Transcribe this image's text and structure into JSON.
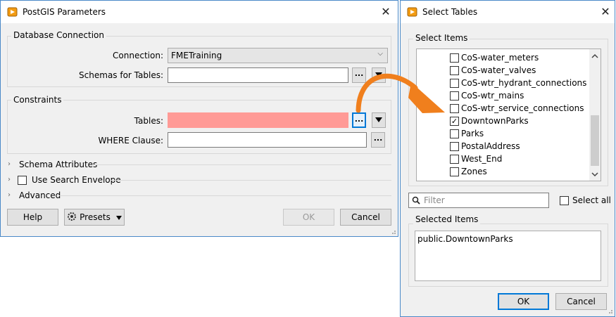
{
  "postgis": {
    "title": "PostGIS Parameters",
    "db_group": "Database Connection",
    "connection_label": "Connection:",
    "connection_value": "FMETraining",
    "schemas_label": "Schemas for Tables:",
    "schemas_value": "",
    "constraints_group": "Constraints",
    "tables_label": "Tables:",
    "tables_value": "",
    "where_label": "WHERE Clause:",
    "where_value": "",
    "ellipsis": "...",
    "schema_attributes": "Schema Attributes",
    "use_search_envelope": "Use Search Envelope",
    "advanced": "Advanced",
    "help": "Help",
    "presets": "Presets",
    "ok": "OK",
    "cancel": "Cancel"
  },
  "select_tables": {
    "title": "Select Tables",
    "select_items_group": "Select Items",
    "items": [
      {
        "label": "CoS-water_meters",
        "checked": false
      },
      {
        "label": "CoS-water_valves",
        "checked": false
      },
      {
        "label": "CoS-wtr_hydrant_connections",
        "checked": false
      },
      {
        "label": "CoS-wtr_mains",
        "checked": false
      },
      {
        "label": "CoS-wtr_service_connections",
        "checked": false
      },
      {
        "label": "DowntownParks",
        "checked": true
      },
      {
        "label": "Parks",
        "checked": false
      },
      {
        "label": "PostalAddress",
        "checked": false
      },
      {
        "label": "West_End",
        "checked": false
      },
      {
        "label": "Zones",
        "checked": false
      }
    ],
    "filter_placeholder": "Filter",
    "select_all": "Select all",
    "selected_items_group": "Selected Items",
    "selected_items": [
      "public.DowntownParks"
    ],
    "ok": "OK",
    "cancel": "Cancel"
  },
  "colors": {
    "highlight_field": "#ff9a96",
    "arrow": "#f07f1d",
    "dialog_border": "#4a89c8"
  }
}
